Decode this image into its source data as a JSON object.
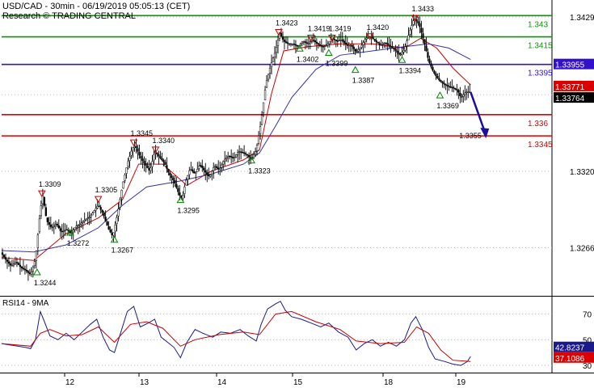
{
  "header": {
    "line1": "USD/CAD - 30min - 06/19/2019 05:05:13 (CET)",
    "line2": "Research © TRADING CENTRAL"
  },
  "chart_data": [
    {
      "type": "line",
      "subtype": "candlestick-price-chart",
      "symbol": "USD/CAD",
      "timeframe": "30min",
      "x_labels": [
        "12",
        "13",
        "14",
        "15",
        "18",
        "19"
      ],
      "ylim": [
        1.3232,
        1.3441
      ],
      "y_ticks": [
        "1.3429",
        "1.3320",
        "1.3266"
      ],
      "grid": "dotted-horizontal",
      "price_path": [
        [
          0,
          1.3262
        ],
        [
          6,
          1.3257
        ],
        [
          12,
          1.3253
        ],
        [
          18,
          1.3256
        ],
        [
          24,
          1.3252
        ],
        [
          30,
          1.325
        ],
        [
          36,
          1.3247
        ],
        [
          42,
          1.3258
        ],
        [
          48,
          1.3292
        ],
        [
          51,
          1.3303
        ],
        [
          56,
          1.3285
        ],
        [
          62,
          1.328
        ],
        [
          68,
          1.3283
        ],
        [
          74,
          1.3277
        ],
        [
          80,
          1.3279
        ],
        [
          86,
          1.3276
        ],
        [
          92,
          1.3281
        ],
        [
          98,
          1.3283
        ],
        [
          104,
          1.3286
        ],
        [
          110,
          1.3288
        ],
        [
          116,
          1.3293
        ],
        [
          120,
          1.3296
        ],
        [
          126,
          1.329
        ],
        [
          132,
          1.328
        ],
        [
          138,
          1.3274
        ],
        [
          144,
          1.329
        ],
        [
          150,
          1.331
        ],
        [
          156,
          1.3325
        ],
        [
          162,
          1.3336
        ],
        [
          166,
          1.3338
        ],
        [
          172,
          1.333
        ],
        [
          178,
          1.3325
        ],
        [
          184,
          1.332
        ],
        [
          190,
          1.3334
        ],
        [
          196,
          1.333
        ],
        [
          202,
          1.3326
        ],
        [
          208,
          1.3318
        ],
        [
          214,
          1.3313
        ],
        [
          220,
          1.3304
        ],
        [
          224,
          1.33
        ],
        [
          228,
          1.3312
        ],
        [
          234,
          1.3322
        ],
        [
          240,
          1.3318
        ],
        [
          246,
          1.3325
        ],
        [
          252,
          1.332
        ],
        [
          258,
          1.3316
        ],
        [
          264,
          1.3324
        ],
        [
          270,
          1.3321
        ],
        [
          276,
          1.3328
        ],
        [
          282,
          1.3331
        ],
        [
          288,
          1.3329
        ],
        [
          294,
          1.3334
        ],
        [
          300,
          1.3333
        ],
        [
          306,
          1.3331
        ],
        [
          310,
          1.3328
        ],
        [
          316,
          1.3335
        ],
        [
          322,
          1.3355
        ],
        [
          328,
          1.3382
        ],
        [
          334,
          1.3395
        ],
        [
          340,
          1.3405
        ],
        [
          345,
          1.3418
        ],
        [
          350,
          1.3412
        ],
        [
          356,
          1.341
        ],
        [
          362,
          1.341
        ],
        [
          368,
          1.3408
        ],
        [
          374,
          1.3412
        ],
        [
          380,
          1.341
        ],
        [
          386,
          1.3413
        ],
        [
          392,
          1.341
        ],
        [
          398,
          1.3408
        ],
        [
          404,
          1.3409
        ],
        [
          410,
          1.3414
        ],
        [
          416,
          1.3412
        ],
        [
          422,
          1.3413
        ],
        [
          428,
          1.3409
        ],
        [
          434,
          1.3409
        ],
        [
          440,
          1.3404
        ],
        [
          446,
          1.3408
        ],
        [
          452,
          1.3414
        ],
        [
          458,
          1.3415
        ],
        [
          464,
          1.3412
        ],
        [
          470,
          1.3409
        ],
        [
          476,
          1.3411
        ],
        [
          482,
          1.3408
        ],
        [
          488,
          1.3406
        ],
        [
          494,
          1.3402
        ],
        [
          500,
          1.3406
        ],
        [
          506,
          1.3418
        ],
        [
          512,
          1.3428
        ],
        [
          518,
          1.3424
        ],
        [
          524,
          1.3412
        ],
        [
          530,
          1.3398
        ],
        [
          536,
          1.339
        ],
        [
          542,
          1.3385
        ],
        [
          548,
          1.3382
        ],
        [
          554,
          1.338
        ],
        [
          560,
          1.3379
        ],
        [
          566,
          1.3377
        ],
        [
          570,
          1.3372
        ],
        [
          576,
          1.3376
        ],
        [
          582,
          1.3376
        ]
      ],
      "series": [
        {
          "name": "Moving average 1",
          "color": "#cc0000",
          "points": [
            [
              0,
              1.3259
            ],
            [
              40,
              1.3257
            ],
            [
              80,
              1.3276
            ],
            [
              120,
              1.3287
            ],
            [
              150,
              1.33
            ],
            [
              170,
              1.3325
            ],
            [
              200,
              1.3325
            ],
            [
              230,
              1.331
            ],
            [
              260,
              1.332
            ],
            [
              300,
              1.3328
            ],
            [
              320,
              1.3335
            ],
            [
              335,
              1.3375
            ],
            [
              350,
              1.3405
            ],
            [
              380,
              1.3408
            ],
            [
              420,
              1.341
            ],
            [
              460,
              1.341
            ],
            [
              500,
              1.3407
            ],
            [
              520,
              1.3414
            ],
            [
              540,
              1.3407
            ],
            [
              560,
              1.3393
            ],
            [
              582,
              1.3381
            ]
          ]
        },
        {
          "name": "Moving average 2",
          "color": "#3333aa",
          "points": [
            [
              0,
              1.3264
            ],
            [
              40,
              1.3263
            ],
            [
              80,
              1.3268
            ],
            [
              120,
              1.328
            ],
            [
              150,
              1.3296
            ],
            [
              180,
              1.3309
            ],
            [
              220,
              1.3313
            ],
            [
              260,
              1.3318
            ],
            [
              300,
              1.3325
            ],
            [
              320,
              1.3333
            ],
            [
              340,
              1.3352
            ],
            [
              360,
              1.3372
            ],
            [
              390,
              1.3392
            ],
            [
              420,
              1.3402
            ],
            [
              460,
              1.3405
            ],
            [
              500,
              1.3408
            ],
            [
              530,
              1.341
            ],
            [
              555,
              1.3407
            ],
            [
              582,
              1.3399
            ]
          ]
        }
      ],
      "levels": [
        {
          "value": 1.343,
          "label": "1.343",
          "color": "#009900"
        },
        {
          "value": 1.3415,
          "label": "1.3415",
          "color": "#009900"
        },
        {
          "value": 1.33955,
          "label": "1.3395",
          "color": "#3311cc"
        },
        {
          "value": 1.336,
          "label": "1.336",
          "color": "#dd0000"
        },
        {
          "value": 1.3345,
          "label": "1.3345",
          "color": "#dd0000"
        }
      ],
      "price_badges": [
        {
          "value": 1.33955,
          "text": "1.33955",
          "bg": "#3311cc",
          "fg": "#ffffff"
        },
        {
          "value": 1.33771,
          "text": "1.33771",
          "bg": "#dd0000",
          "fg": "#ffffff"
        },
        {
          "value": 1.33764,
          "text": "1.33764",
          "bg": "#000000",
          "fg": "#ffffff"
        }
      ],
      "swing_labels": [
        {
          "x": 44,
          "price": 1.3244,
          "text": "1.3244",
          "kind": "low"
        },
        {
          "x": 50,
          "price": 1.3309,
          "text": "1.3309",
          "kind": "high"
        },
        {
          "x": 85,
          "price": 1.3272,
          "text": "1.3272",
          "kind": "low"
        },
        {
          "x": 120,
          "price": 1.3305,
          "text": "1.3305",
          "kind": "high"
        },
        {
          "x": 140,
          "price": 1.3267,
          "text": "1.3267",
          "kind": "low"
        },
        {
          "x": 164,
          "price": 1.3345,
          "text": "1.3345",
          "kind": "high"
        },
        {
          "x": 191,
          "price": 1.334,
          "text": "1.3340",
          "kind": "high"
        },
        {
          "x": 222,
          "price": 1.3295,
          "text": "1.3295",
          "kind": "low"
        },
        {
          "x": 310,
          "price": 1.3323,
          "text": "1.3323",
          "kind": "low"
        },
        {
          "x": 344,
          "price": 1.3423,
          "text": "1.3423",
          "kind": "high"
        },
        {
          "x": 370,
          "price": 1.3402,
          "text": "1.3402",
          "kind": "low"
        },
        {
          "x": 384,
          "price": 1.3419,
          "text": "1.3419",
          "kind": "high"
        },
        {
          "x": 406,
          "price": 1.3399,
          "text": "1.3399",
          "kind": "low"
        },
        {
          "x": 410,
          "price": 1.3419,
          "text": "1.3419",
          "kind": "high"
        },
        {
          "x": 439,
          "price": 1.3387,
          "text": "1.3387",
          "kind": "low"
        },
        {
          "x": 457,
          "price": 1.342,
          "text": "1.3420",
          "kind": "high"
        },
        {
          "x": 497,
          "price": 1.3394,
          "text": "1.3394",
          "kind": "low"
        },
        {
          "x": 513,
          "price": 1.3433,
          "text": "1.3433",
          "kind": "high"
        },
        {
          "x": 544,
          "price": 1.3369,
          "text": "1.3369",
          "kind": "low"
        }
      ],
      "forecast_arrow": {
        "from": [
          582,
          1.3376
        ],
        "to": [
          600,
          1.3345
        ],
        "color": "#1a0ea0"
      },
      "target_label": "1.3355"
    },
    {
      "type": "line",
      "subtype": "oscillator",
      "title": "RSI14 - 9MA",
      "ylim": [
        25,
        83
      ],
      "y_ticks": [
        "70",
        "50",
        "30"
      ],
      "series": [
        {
          "name": "RSI14",
          "color": "#1a1a8c",
          "points": [
            [
              0,
              47
            ],
            [
              10,
              46
            ],
            [
              20,
              45
            ],
            [
              30,
              44
            ],
            [
              36,
              43
            ],
            [
              42,
              50
            ],
            [
              48,
              72
            ],
            [
              52,
              66
            ],
            [
              60,
              53
            ],
            [
              70,
              50
            ],
            [
              80,
              55
            ],
            [
              90,
              50
            ],
            [
              100,
              56
            ],
            [
              110,
              62
            ],
            [
              118,
              66
            ],
            [
              126,
              52
            ],
            [
              134,
              42
            ],
            [
              140,
              40
            ],
            [
              148,
              56
            ],
            [
              156,
              72
            ],
            [
              164,
              76
            ],
            [
              172,
              60
            ],
            [
              182,
              63
            ],
            [
              190,
              66
            ],
            [
              198,
              52
            ],
            [
              206,
              48
            ],
            [
              214,
              44
            ],
            [
              222,
              36
            ],
            [
              230,
              48
            ],
            [
              240,
              58
            ],
            [
              250,
              55
            ],
            [
              262,
              52
            ],
            [
              272,
              56
            ],
            [
              284,
              55
            ],
            [
              296,
              58
            ],
            [
              306,
              53
            ],
            [
              316,
              49
            ],
            [
              322,
              62
            ],
            [
              330,
              74
            ],
            [
              340,
              78
            ],
            [
              346,
              80
            ],
            [
              352,
              73
            ],
            [
              360,
              68
            ],
            [
              372,
              66
            ],
            [
              384,
              63
            ],
            [
              396,
              60
            ],
            [
              406,
              63
            ],
            [
              418,
              56
            ],
            [
              430,
              52
            ],
            [
              440,
              42
            ],
            [
              450,
              47
            ],
            [
              460,
              50
            ],
            [
              470,
              45
            ],
            [
              480,
              48
            ],
            [
              490,
              45
            ],
            [
              500,
              50
            ],
            [
              508,
              63
            ],
            [
              514,
              68
            ],
            [
              522,
              58
            ],
            [
              530,
              44
            ],
            [
              538,
              35
            ],
            [
              550,
              33
            ],
            [
              560,
              31
            ],
            [
              570,
              30
            ],
            [
              578,
              33
            ],
            [
              582,
              37
            ]
          ]
        },
        {
          "name": "9MA",
          "color": "#cc0000",
          "points": [
            [
              0,
              47
            ],
            [
              36,
              45
            ],
            [
              48,
              55
            ],
            [
              60,
              58
            ],
            [
              80,
              53
            ],
            [
              100,
              54
            ],
            [
              120,
              60
            ],
            [
              140,
              48
            ],
            [
              160,
              62
            ],
            [
              180,
              64
            ],
            [
              200,
              59
            ],
            [
              222,
              45
            ],
            [
              240,
              50
            ],
            [
              270,
              54
            ],
            [
              300,
              56
            ],
            [
              320,
              54
            ],
            [
              340,
              70
            ],
            [
              360,
              72
            ],
            [
              390,
              64
            ],
            [
              420,
              58
            ],
            [
              440,
              49
            ],
            [
              470,
              47
            ],
            [
              500,
              48
            ],
            [
              515,
              60
            ],
            [
              530,
              55
            ],
            [
              545,
              42
            ],
            [
              560,
              34
            ],
            [
              582,
              33
            ]
          ]
        }
      ],
      "value_badges": [
        {
          "value": 42.8237,
          "text": "42.8237",
          "bg": "#1a1a8c",
          "fg": "#ffffff"
        },
        {
          "value": 37.1086,
          "text": "37.1086",
          "bg": "#dd0000",
          "fg": "#ffffff"
        }
      ]
    }
  ]
}
